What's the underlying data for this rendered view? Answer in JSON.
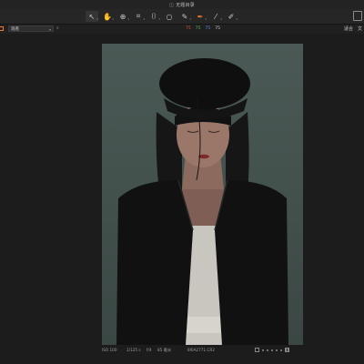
{
  "window": {
    "title": "无题目录"
  },
  "toolbar": {
    "tools": [
      {
        "name": "pointer-tool",
        "glyph": "↖"
      },
      {
        "name": "hand-tool",
        "glyph": "✋"
      },
      {
        "name": "zoom-tool",
        "glyph": "⊕"
      },
      {
        "name": "crop-tool",
        "glyph": "⌗"
      },
      {
        "name": "keystone-tool",
        "glyph": "⌷"
      },
      {
        "name": "mask-tool",
        "glyph": "○"
      },
      {
        "name": "brush-tool",
        "glyph": "✎"
      },
      {
        "name": "color-picker-tool",
        "glyph": "✒"
      },
      {
        "name": "white-balance-tool",
        "glyph": "⁄"
      },
      {
        "name": "annotate-tool",
        "glyph": "✐"
      }
    ]
  },
  "viewer": {
    "view_mode": "观看",
    "rgb": {
      "r": "75",
      "g": "75",
      "b": "75",
      "a": "75"
    },
    "fit_label": "适合",
    "fit_extra": "文"
  },
  "image_info": {
    "iso": "ISO 100",
    "shutter": "1/125 s",
    "aperture": "f/4",
    "focal": "85 毫米",
    "filename": "8I0A2771.CR2"
  },
  "colors": {
    "accent": "#f07a2b",
    "background": "#1b1b1b"
  }
}
